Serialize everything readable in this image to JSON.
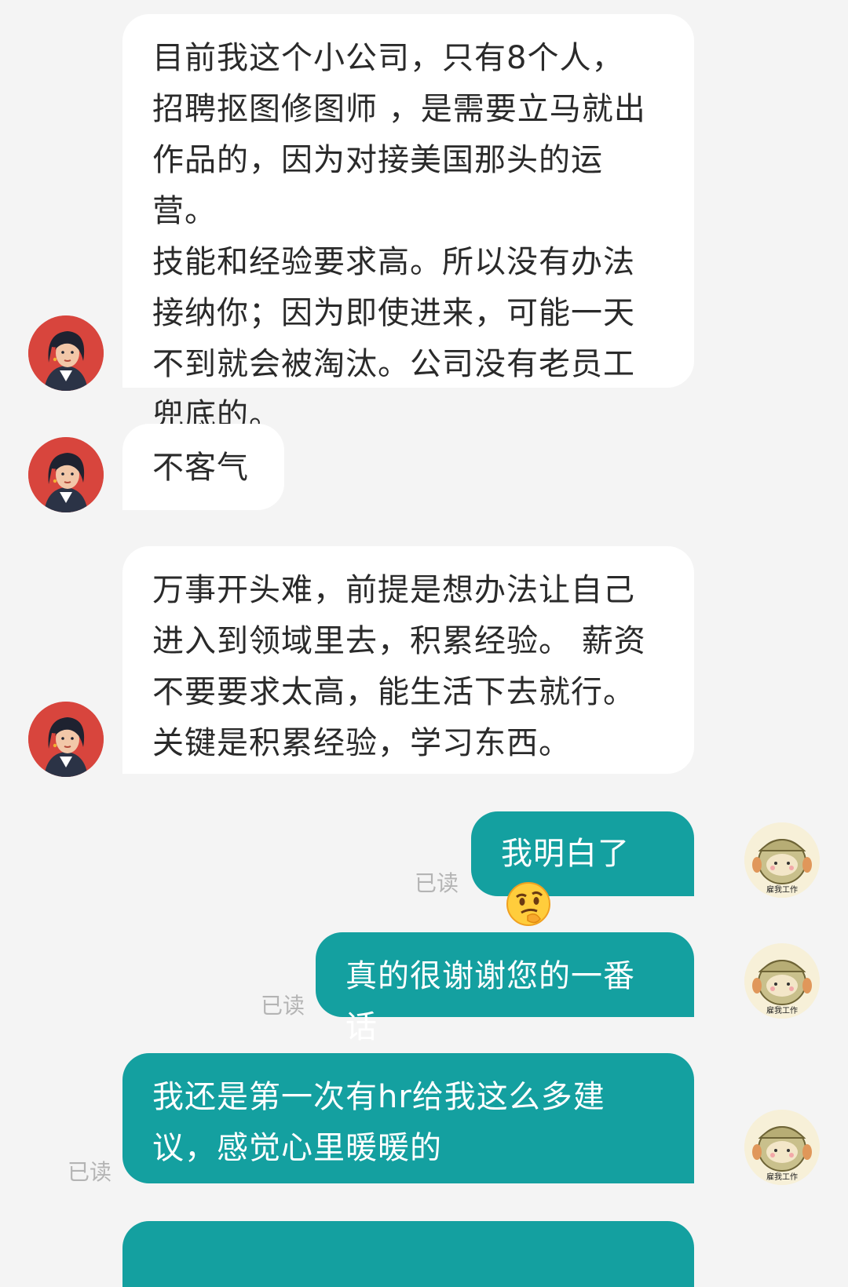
{
  "messages": [
    {
      "side": "in",
      "lines": [
        "目前我这个小公司，只有8个人，",
        "招聘抠图修图师 ，是需要立马就出",
        "作品的，因为对接美国那头的运营。",
        "技能和经验要求高。所以没有办法",
        "接纳你；因为即使进来，可能一天",
        "不到就会被淘汰。公司没有老员工",
        "兜底的。"
      ]
    },
    {
      "side": "in",
      "lines": [
        "不客气"
      ]
    },
    {
      "side": "in",
      "lines": [
        "万事开头难，前提是想办法让自己",
        "进入到领域里去，积累经验。 薪资",
        "不要要求太高，能生活下去就行。",
        "关键是积累经验，学习东西。"
      ]
    },
    {
      "side": "out",
      "text": "我明白了",
      "emoji": "thinking-face-emoji",
      "status": "已读"
    },
    {
      "side": "out",
      "text": "真的很谢谢您的一番话",
      "status": "已读"
    },
    {
      "side": "out",
      "lines": [
        "我还是第一次有hr给我这么多建",
        "议，感觉心里暖暖的"
      ],
      "status": "已读"
    }
  ],
  "avatar_caption": "雇我工作",
  "colors": {
    "background": "#f4f4f4",
    "incoming_bubble": "#ffffff",
    "outgoing_bubble": "#14a0a0",
    "read_status": "#b4b4b4",
    "hr_avatar_bg": "#d8453d"
  }
}
